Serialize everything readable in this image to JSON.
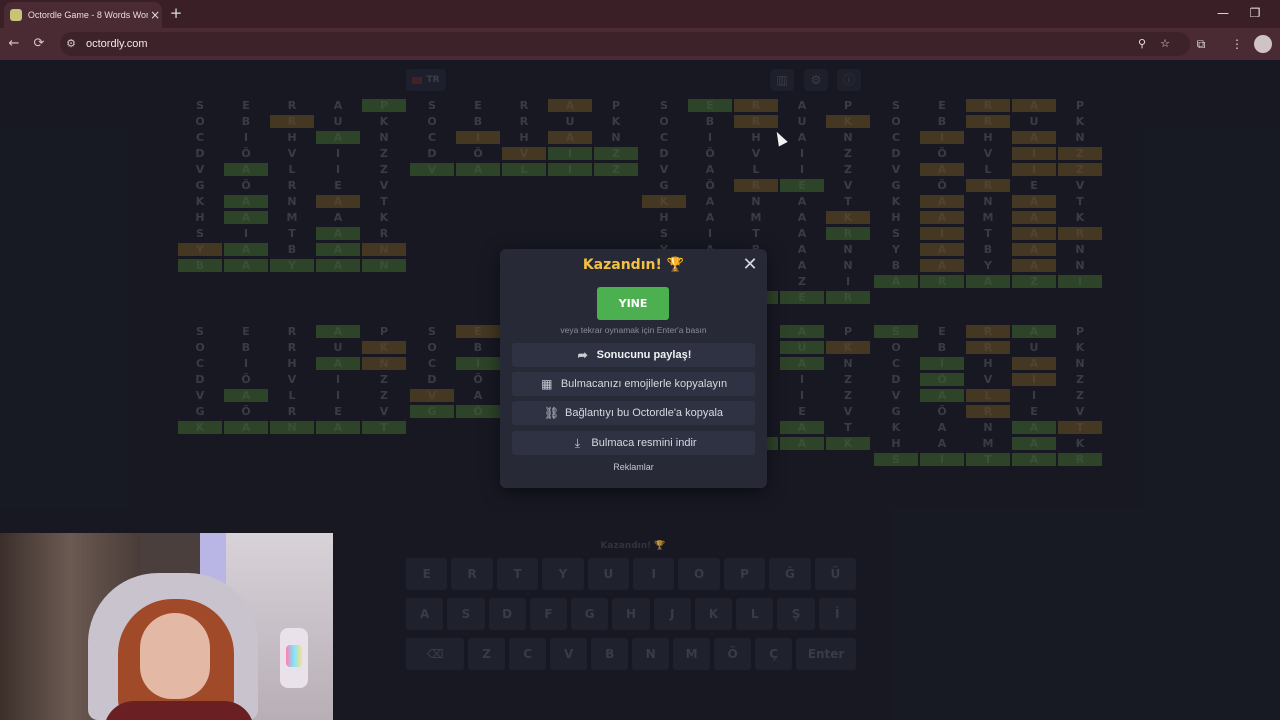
{
  "browser": {
    "tab_title": "Octordle Game - 8 Words Wordle",
    "url": "octordly.com",
    "icons": {
      "close_tab": "×",
      "new_tab": "+",
      "minimize": "—",
      "restore": "❐",
      "back": "←",
      "forward": "→",
      "reload": "⟳",
      "zoom": "⚲",
      "star": "☆",
      "extensions": "⧉",
      "menu": "⋮"
    }
  },
  "header": {
    "lang_label": "TR",
    "buttons": [
      "stats-icon",
      "settings-icon",
      "info-icon"
    ]
  },
  "boards": [
    {
      "rows": [
        [
          "S",
          "E",
          "R",
          "A",
          "P"
        ],
        [
          "O",
          "B",
          "R",
          "U",
          "K"
        ],
        [
          "C",
          "I",
          "H",
          "A",
          "N"
        ],
        [
          "D",
          "Ö",
          "V",
          "I",
          "Z"
        ],
        [
          "V",
          "A",
          "L",
          "I",
          "Z"
        ],
        [
          "G",
          "Ö",
          "R",
          "E",
          "V"
        ],
        [
          "K",
          "A",
          "N",
          "A",
          "T"
        ],
        [
          "H",
          "A",
          "M",
          "A",
          "K"
        ],
        [
          "S",
          "I",
          "T",
          "A",
          "R"
        ],
        [
          "Y",
          "A",
          "B",
          "A",
          "N"
        ],
        [
          "B",
          "A",
          "Y",
          "A",
          "N"
        ]
      ],
      "marks": [
        "....g",
        "..y..",
        "...g.",
        ".....",
        ".g...",
        ".....",
        ".g.y.",
        ".g...",
        "...g.",
        "yg.gy",
        "ggggg"
      ]
    },
    {
      "rows": [
        [
          "S",
          "E",
          "R",
          "A",
          "P"
        ],
        [
          "O",
          "B",
          "R",
          "U",
          "K"
        ],
        [
          "C",
          "I",
          "H",
          "A",
          "N"
        ],
        [
          "D",
          "Ö",
          "V",
          "I",
          "Z"
        ],
        [
          "V",
          "A",
          "L",
          "I",
          "Z"
        ]
      ],
      "marks": [
        "...y.",
        ".....",
        ".y.y.",
        "..ygg",
        "ggggg"
      ]
    },
    {
      "rows": [
        [
          "S",
          "E",
          "R",
          "A",
          "P"
        ],
        [
          "O",
          "B",
          "R",
          "U",
          "K"
        ],
        [
          "C",
          "I",
          "H",
          "A",
          "N"
        ],
        [
          "D",
          "Ö",
          "V",
          "I",
          "Z"
        ],
        [
          "V",
          "A",
          "L",
          "I",
          "Z"
        ],
        [
          "G",
          "Ö",
          "R",
          "E",
          "V"
        ],
        [
          "K",
          "A",
          "N",
          "A",
          "T"
        ],
        [
          "H",
          "A",
          "M",
          "A",
          "K"
        ],
        [
          "S",
          "I",
          "T",
          "A",
          "R"
        ],
        [
          "Y",
          "A",
          "B",
          "A",
          "N"
        ],
        [
          "B",
          "A",
          "Y",
          "A",
          "N"
        ],
        [
          "A",
          "R",
          "A",
          "Z",
          "I"
        ],
        [
          "K",
          "A",
          "R",
          "E",
          "R"
        ]
      ],
      "marks": [
        ".gy..",
        "..y.y",
        ".....",
        ".....",
        ".....",
        "..yg.",
        "y....",
        "....y",
        "....g",
        ".....",
        ".....",
        ".....",
        "ggggg"
      ]
    },
    {
      "rows": [
        [
          "S",
          "E",
          "R",
          "A",
          "P"
        ],
        [
          "O",
          "B",
          "R",
          "U",
          "K"
        ],
        [
          "C",
          "I",
          "H",
          "A",
          "N"
        ],
        [
          "D",
          "Ö",
          "V",
          "I",
          "Z"
        ],
        [
          "V",
          "A",
          "L",
          "I",
          "Z"
        ],
        [
          "G",
          "Ö",
          "R",
          "E",
          "V"
        ],
        [
          "K",
          "A",
          "N",
          "A",
          "T"
        ],
        [
          "H",
          "A",
          "M",
          "A",
          "K"
        ],
        [
          "S",
          "I",
          "T",
          "A",
          "R"
        ],
        [
          "Y",
          "A",
          "B",
          "A",
          "N"
        ],
        [
          "B",
          "A",
          "Y",
          "A",
          "N"
        ],
        [
          "A",
          "R",
          "A",
          "Z",
          "I"
        ]
      ],
      "marks": [
        "..yy.",
        "..y..",
        ".y.y.",
        "...yy",
        ".y.yy",
        "..y..",
        ".y.y.",
        ".y.y.",
        ".y.yy",
        ".y.y.",
        ".y.y.",
        "ggggg"
      ]
    },
    {
      "rows": [
        [
          "S",
          "E",
          "R",
          "A",
          "P"
        ],
        [
          "O",
          "B",
          "R",
          "U",
          "K"
        ],
        [
          "C",
          "I",
          "H",
          "A",
          "N"
        ],
        [
          "D",
          "Ö",
          "V",
          "I",
          "Z"
        ],
        [
          "V",
          "A",
          "L",
          "I",
          "Z"
        ],
        [
          "G",
          "Ö",
          "R",
          "E",
          "V"
        ],
        [
          "K",
          "A",
          "N",
          "A",
          "T"
        ]
      ],
      "marks": [
        "...g.",
        "....y",
        "...gy",
        ".....",
        ".g...",
        ".....",
        "ggggg"
      ]
    },
    {
      "rows": [
        [
          "S",
          "E",
          "R",
          "A",
          "P"
        ],
        [
          "O",
          "B",
          "R",
          "U",
          "K"
        ],
        [
          "C",
          "I",
          "H",
          "A",
          "N"
        ],
        [
          "D",
          "Ö",
          "V",
          "I",
          "Z"
        ],
        [
          "V",
          "A",
          "L",
          "I",
          "Z"
        ],
        [
          "G",
          "Ö",
          "R",
          "E",
          "V"
        ]
      ],
      "marks": [
        ".y...",
        ".....",
        ".g...",
        "..g..",
        "y.g..",
        "ggggg"
      ]
    },
    {
      "rows": [
        [
          "S",
          "E",
          "R",
          "A",
          "P"
        ],
        [
          "O",
          "B",
          "R",
          "U",
          "K"
        ],
        [
          "C",
          "I",
          "H",
          "A",
          "N"
        ],
        [
          "D",
          "Ö",
          "V",
          "I",
          "Z"
        ],
        [
          "V",
          "A",
          "L",
          "I",
          "Z"
        ],
        [
          "G",
          "Ö",
          "R",
          "E",
          "V"
        ],
        [
          "K",
          "A",
          "N",
          "A",
          "T"
        ],
        [
          "H",
          "A",
          "M",
          "A",
          "K"
        ]
      ],
      "marks": [
        "...g.",
        "...gy",
        "...g.",
        ".....",
        ".....",
        ".....",
        "...g.",
        "ggggg"
      ]
    },
    {
      "rows": [
        [
          "S",
          "E",
          "R",
          "A",
          "P"
        ],
        [
          "O",
          "B",
          "R",
          "U",
          "K"
        ],
        [
          "C",
          "I",
          "H",
          "A",
          "N"
        ],
        [
          "D",
          "Ö",
          "V",
          "I",
          "Z"
        ],
        [
          "V",
          "A",
          "L",
          "I",
          "Z"
        ],
        [
          "G",
          "Ö",
          "R",
          "E",
          "V"
        ],
        [
          "K",
          "A",
          "N",
          "A",
          "T"
        ],
        [
          "H",
          "A",
          "M",
          "A",
          "K"
        ],
        [
          "S",
          "I",
          "T",
          "A",
          "R"
        ]
      ],
      "marks": [
        "g.yg.",
        "..y..",
        ".g.y.",
        ".g.y.",
        ".gy..",
        "..y..",
        "...gy",
        "...g.",
        "ggggg"
      ]
    }
  ],
  "keyboard": {
    "title": "Kazandın! 🏆",
    "row1": [
      "E",
      "R",
      "T",
      "Y",
      "U",
      "I",
      "O",
      "P",
      "Ğ",
      "Ü"
    ],
    "row2": [
      "A",
      "S",
      "D",
      "F",
      "G",
      "H",
      "J",
      "K",
      "L",
      "Ş",
      "İ"
    ],
    "row3": [
      "⌫",
      "Z",
      "C",
      "V",
      "B",
      "N",
      "M",
      "Ö",
      "Ç",
      "Enter"
    ]
  },
  "modal": {
    "title": "Kazandın! 🏆",
    "again_label": "YINE",
    "hint": "veya tekrar oynamak için Enter'a basın",
    "share_label": "Sonucunu paylaş!",
    "emoji_label": "Bulmacanızı emojilerle kopyalayın",
    "link_label": "Bağlantıyı bu Octordle'a kopyala",
    "download_label": "Bulmaca resmini indir",
    "ads_label": "Reklamlar",
    "close_glyph": "✕",
    "icons": {
      "share": "➦",
      "emoji": "▦",
      "link": "⛓",
      "download": "⤓"
    }
  },
  "colors": {
    "green": "#3c5a33",
    "yellow": "#5a4a2a",
    "accent": "#4caf50",
    "title": "#f2c043"
  }
}
